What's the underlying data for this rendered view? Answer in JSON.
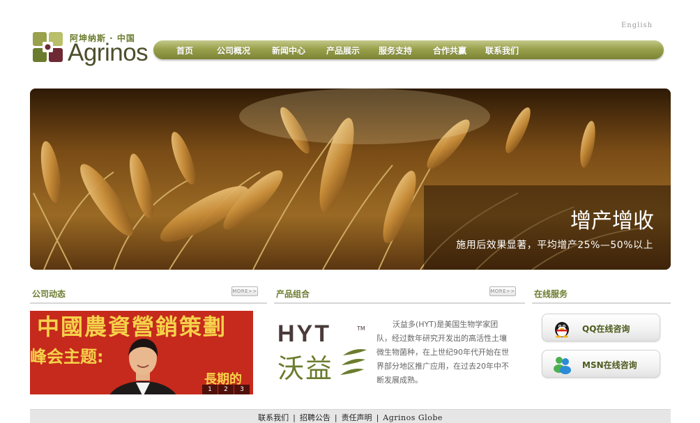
{
  "header": {
    "lang_link": "English",
    "logo_cn": "阿坤纳斯 · 中国",
    "logo_en": "Agrinos"
  },
  "nav": {
    "items": [
      "首页",
      "公司概况",
      "新闻中心",
      "产品展示",
      "服务支持",
      "合作共赢",
      "联系我们"
    ]
  },
  "banner": {
    "title": "增产增收",
    "subtitle": "施用后效果显著，平均增产25%—50%以上"
  },
  "news": {
    "title": "公司动态",
    "more": "MORE>>",
    "photo_text": "中國農資營銷策劃",
    "photo_text2": "峰会主题:",
    "photo_text3": "長期的",
    "pages": [
      "1",
      "2",
      "3"
    ]
  },
  "products": {
    "title": "产品组合",
    "more": "MORE>>",
    "logo_en": "HYT",
    "logo_cn": "沃益",
    "tm": "TM",
    "description": "沃益多(HYT)是美国生物学家团队，经过数年研究开发出的高活性土壤微生物菌种，在上世纪90年代开始在世界部分地区推广应用，在过去20年中不断发展成熟。"
  },
  "service": {
    "title": "在线服务",
    "qq": "QQ在线咨询",
    "msn": "MSN在线咨询"
  },
  "footer": {
    "links": [
      "联系我们",
      "招聘公告",
      "责任声明",
      "Agrinos Globe"
    ],
    "separator": "|"
  },
  "colors": {
    "brand_green": "#6b7c2e",
    "nav_green": "#9aa14d"
  }
}
